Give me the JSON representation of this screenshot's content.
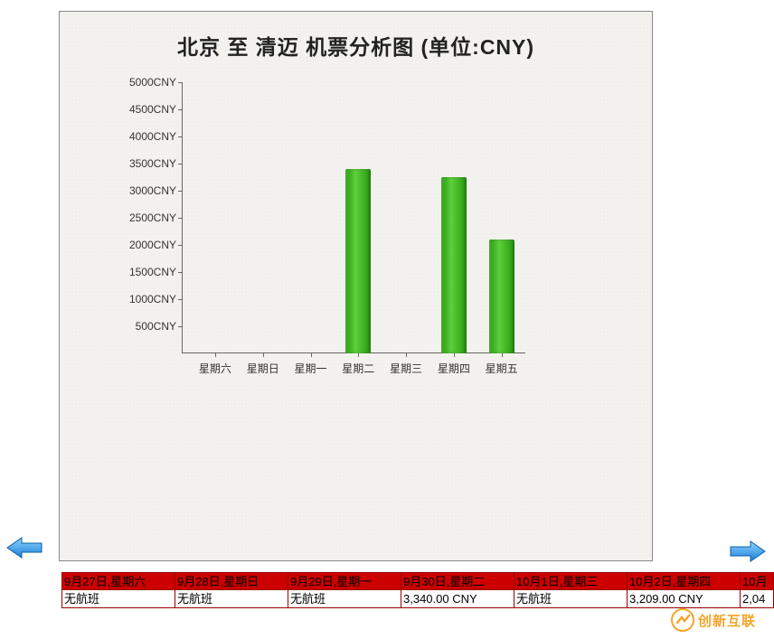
{
  "chart_data": {
    "type": "bar",
    "title": "北京  至  清迈  机票分析图  (单位:CNY)",
    "categories": [
      "星期六",
      "星期日",
      "星期一",
      "星期二",
      "星期三",
      "星期四",
      "星期五"
    ],
    "values": [
      0,
      0,
      0,
      3400,
      0,
      3250,
      2100
    ],
    "y_ticks": [
      500,
      1000,
      1500,
      2000,
      2500,
      3000,
      3500,
      4000,
      4500,
      5000
    ],
    "y_tick_suffix": "CNY",
    "ylim": [
      0,
      5000
    ],
    "xlabel": "",
    "ylabel": ""
  },
  "table": {
    "headers": [
      "9月27日,星期六",
      "9月28日,星期日",
      "9月29日,星期一",
      "9月30日,星期二",
      "10月1日,星期三",
      "10月2日,星期四",
      "10月"
    ],
    "values": [
      "无航班",
      "无航班",
      "无航班",
      "3,340.00 CNY",
      "无航班",
      "3,209.00 CNY",
      "2,04"
    ]
  },
  "watermark": {
    "text": "创新互联"
  }
}
